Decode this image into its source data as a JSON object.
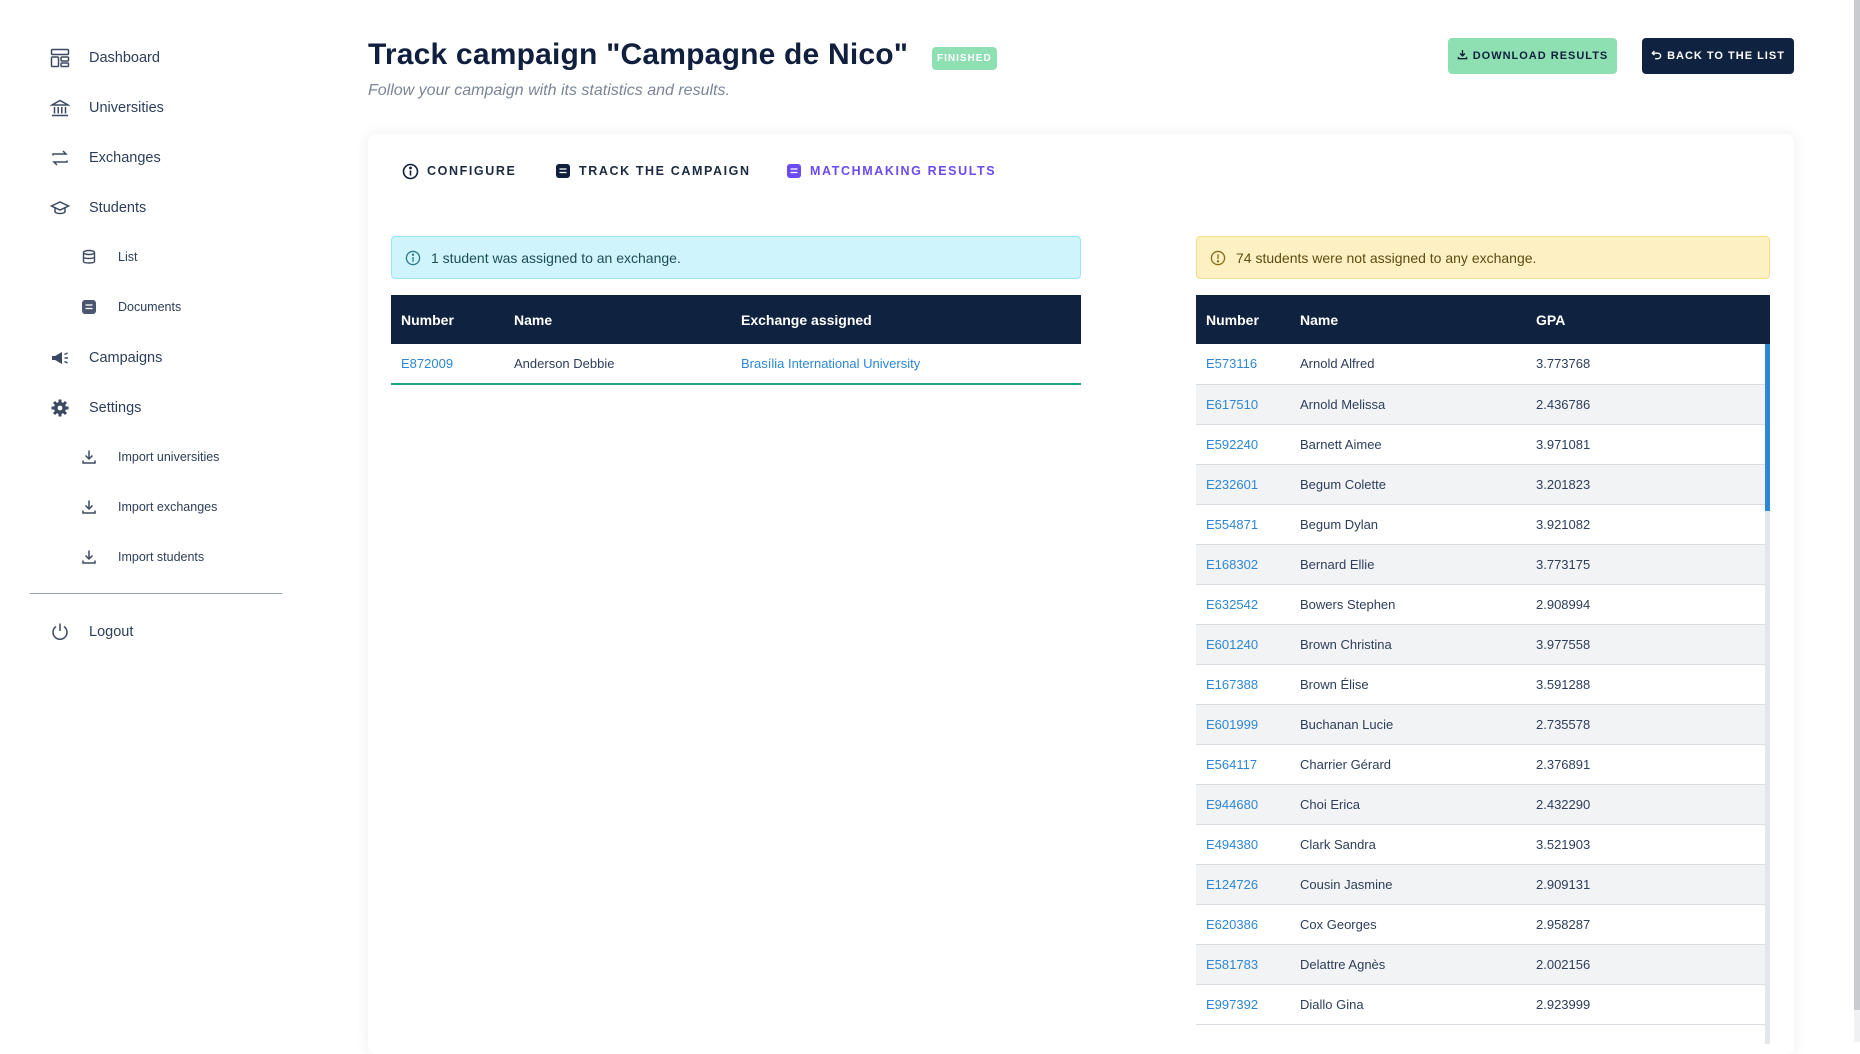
{
  "sidebar": {
    "items": [
      {
        "label": "Dashboard",
        "icon": "dashboard-icon"
      },
      {
        "label": "Universities",
        "icon": "university-icon"
      },
      {
        "label": "Exchanges",
        "icon": "exchange-icon"
      },
      {
        "label": "Students",
        "icon": "graduation-cap-icon"
      },
      {
        "label": "List",
        "icon": "database-icon"
      },
      {
        "label": "Documents",
        "icon": "document-icon"
      },
      {
        "label": "Campaigns",
        "icon": "megaphone-icon"
      },
      {
        "label": "Settings",
        "icon": "gear-icon"
      },
      {
        "label": "Import universities",
        "icon": "download-icon"
      },
      {
        "label": "Import exchanges",
        "icon": "download-icon"
      },
      {
        "label": "Import students",
        "icon": "download-icon"
      },
      {
        "label": "Logout",
        "icon": "power-icon"
      }
    ]
  },
  "header": {
    "title": "Track campaign \"Campagne de Nico\"",
    "status": "FINISHED",
    "subtitle": "Follow your campaign with its statistics and results.",
    "download_label": "DOWNLOAD RESULTS",
    "back_label": "BACK TO THE LIST"
  },
  "tabs": [
    {
      "label": "CONFIGURE",
      "active": false
    },
    {
      "label": "TRACK THE CAMPAIGN",
      "active": false
    },
    {
      "label": "MATCHMAKING RESULTS",
      "active": true
    }
  ],
  "assigned": {
    "alert": "1 student was assigned to an exchange.",
    "columns": [
      "Number",
      "Name",
      "Exchange assigned"
    ],
    "rows": [
      {
        "number": "E872009",
        "name": "Anderson Debbie",
        "exchange": "Brasília International University"
      }
    ]
  },
  "unassigned": {
    "alert": "74 students were not assigned to any exchange.",
    "columns": [
      "Number",
      "Name",
      "GPA"
    ],
    "rows": [
      {
        "number": "E573116",
        "name": "Arnold Alfred",
        "gpa": "3.773768"
      },
      {
        "number": "E617510",
        "name": "Arnold Melissa",
        "gpa": "2.436786"
      },
      {
        "number": "E592240",
        "name": "Barnett Aimee",
        "gpa": "3.971081"
      },
      {
        "number": "E232601",
        "name": "Begum Colette",
        "gpa": "3.201823"
      },
      {
        "number": "E554871",
        "name": "Begum Dylan",
        "gpa": "3.921082"
      },
      {
        "number": "E168302",
        "name": "Bernard Ellie",
        "gpa": "3.773175"
      },
      {
        "number": "E632542",
        "name": "Bowers Stephen",
        "gpa": "2.908994"
      },
      {
        "number": "E601240",
        "name": "Brown Christina",
        "gpa": "3.977558"
      },
      {
        "number": "E167388",
        "name": "Brown Élise",
        "gpa": "3.591288"
      },
      {
        "number": "E601999",
        "name": "Buchanan Lucie",
        "gpa": "2.735578"
      },
      {
        "number": "E564117",
        "name": "Charrier Gérard",
        "gpa": "2.376891"
      },
      {
        "number": "E944680",
        "name": "Choi Erica",
        "gpa": "2.432290"
      },
      {
        "number": "E494380",
        "name": "Clark Sandra",
        "gpa": "3.521903"
      },
      {
        "number": "E124726",
        "name": "Cousin Jasmine",
        "gpa": "2.909131"
      },
      {
        "number": "E620386",
        "name": "Cox Georges",
        "gpa": "2.958287"
      },
      {
        "number": "E581783",
        "name": "Delattre Agnès",
        "gpa": "2.002156"
      },
      {
        "number": "E997392",
        "name": "Diallo Gina",
        "gpa": "2.923999"
      }
    ]
  },
  "colors": {
    "navy": "#0f2340",
    "accent_purple": "#6a4bf2",
    "green_badge": "#8ee0b2",
    "link_blue": "#2d87d6"
  }
}
